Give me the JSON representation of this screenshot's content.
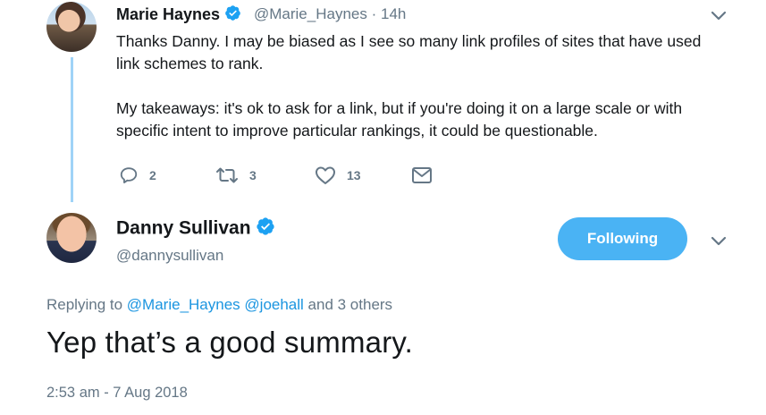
{
  "reply_tweet": {
    "author_name": "Marie Haynes",
    "handle": "@Marie_Haynes",
    "separator": "·",
    "time": "14h",
    "paragraphs": [
      "Thanks Danny. I may be biased as I see so many link profiles of sites that have used link schemes to rank.",
      "My takeaways: it's ok to ask for a link, but if you're doing it on a large scale or with specific intent to improve particular rankings, it could be questionable."
    ],
    "actions": {
      "replies": "2",
      "retweets": "3",
      "likes": "13"
    },
    "icons": [
      "reply-icon",
      "retweet-icon",
      "like-icon",
      "direct-message-icon",
      "chevron-down-icon",
      "verified-badge-icon"
    ]
  },
  "main_tweet": {
    "author_name": "Danny Sullivan",
    "handle": "@dannysullivan",
    "follow_button_label": "Following",
    "replying_prefix": "Replying to",
    "replying_mentions": [
      "@Marie_Haynes",
      "@joehall"
    ],
    "replying_suffix": "and 3 others",
    "text": "Yep that’s a good summary.",
    "timestamp": "2:53 am - 7 Aug 2018"
  },
  "colors": {
    "accent": "#1b95e0",
    "follow_button_bg": "#4ab3f4",
    "thread_line": "#9fd3f7",
    "muted_text": "#657786",
    "primary_text": "#14171a"
  }
}
